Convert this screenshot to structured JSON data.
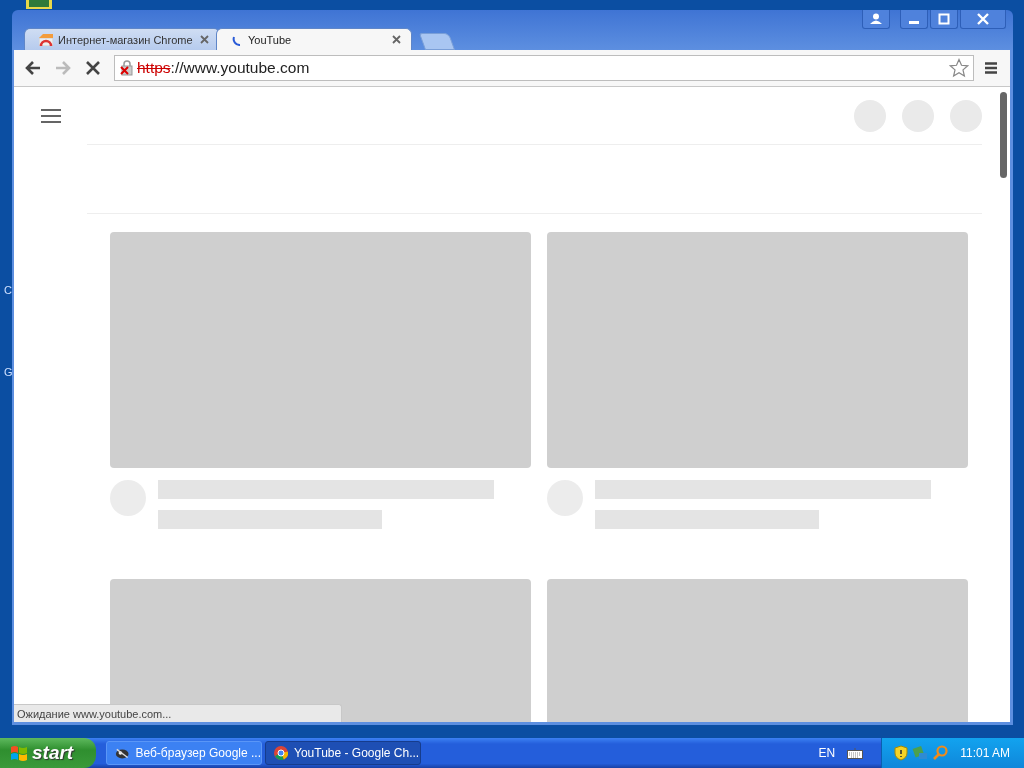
{
  "desktop": {
    "edge_letters": [
      "C",
      "G"
    ]
  },
  "window": {
    "tabs": [
      {
        "title": "Интернет-магазин Chrome",
        "selected": false,
        "loading": false
      },
      {
        "title": "YouTube",
        "selected": true,
        "loading": true
      }
    ]
  },
  "toolbar": {
    "loading": true,
    "address": {
      "scheme": "https",
      "insecure": true,
      "rest": "://www.youtube.com"
    },
    "bookmarked": false
  },
  "status_bubble": "Ожидание www.youtube.com...",
  "taskbar": {
    "start": "start",
    "tasks": [
      {
        "label": "Веб-браузер Google ...",
        "selected": false,
        "kind": "app"
      },
      {
        "label": "YouTube - Google Ch...",
        "selected": true,
        "kind": "browser"
      }
    ],
    "language": "EN",
    "clock": "11:01 AM"
  }
}
